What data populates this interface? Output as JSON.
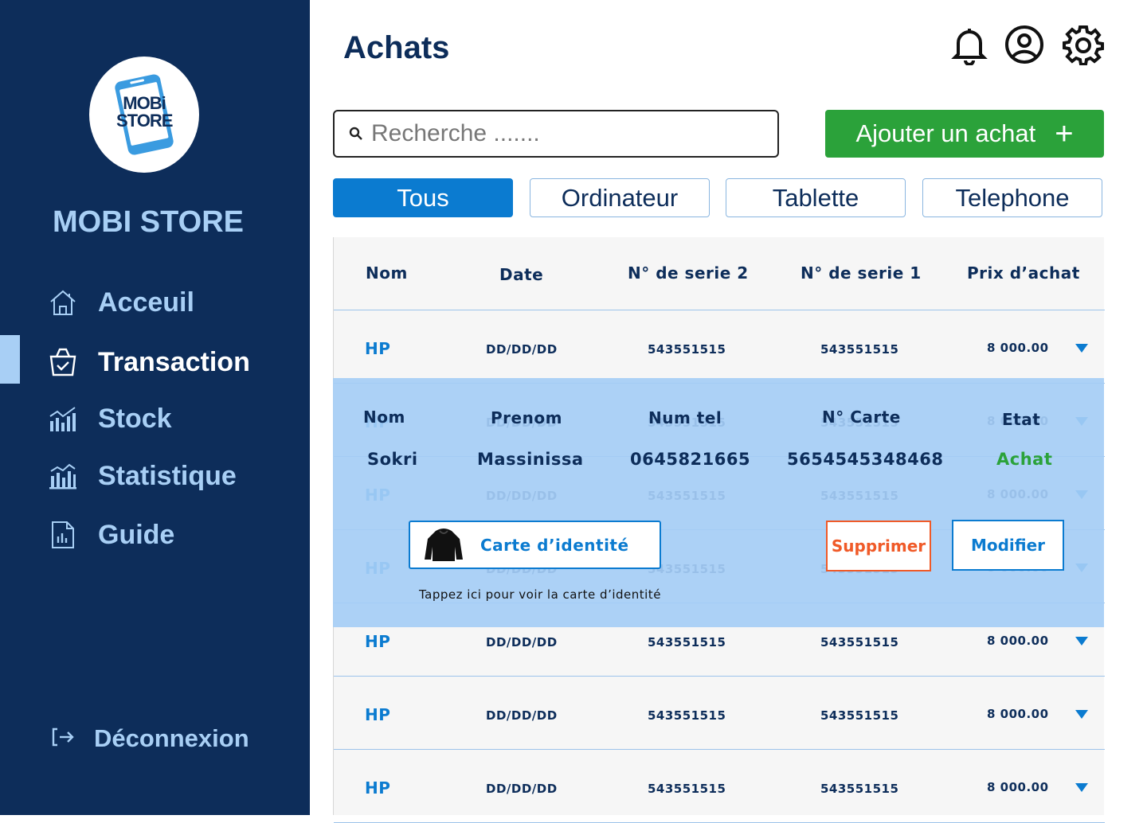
{
  "sidebar": {
    "logo_line1": "MOBi",
    "logo_line2": "STORE",
    "brand": "MOBI STORE",
    "nav": [
      {
        "label": "Acceuil",
        "icon": "home-icon"
      },
      {
        "label": "Transaction",
        "icon": "basket-check-icon",
        "active": true
      },
      {
        "label": "Stock",
        "icon": "bar-chart-icon"
      },
      {
        "label": "Statistique",
        "icon": "stats-chart-icon"
      },
      {
        "label": "Guide",
        "icon": "document-icon"
      }
    ],
    "logout": "Déconnexion"
  },
  "header": {
    "title": "Achats",
    "icons": [
      "bell-icon",
      "user-icon",
      "gear-icon"
    ]
  },
  "search": {
    "placeholder": "Recherche ......."
  },
  "add_button": {
    "label": "Ajouter un achat",
    "icon": "+"
  },
  "tabs": [
    {
      "label": "Tous",
      "active": true
    },
    {
      "label": "Ordinateur"
    },
    {
      "label": "Tablette"
    },
    {
      "label": "Telephone"
    }
  ],
  "table": {
    "columns": [
      "Nom",
      "Date",
      "N° de serie 2",
      "N° de serie 1",
      "Prix d’achat"
    ],
    "rows": [
      {
        "nom": "HP",
        "date": "DD/DD/DD",
        "serie2": "543551515",
        "serie1": "543551515",
        "prix": "8 000.00"
      },
      {
        "nom": "HP",
        "date": "DD/DD/DD",
        "serie2": "543551515",
        "serie1": "543551515",
        "prix": "8 000.00"
      },
      {
        "nom": "HP",
        "date": "DD/DD/DD",
        "serie2": "543551515",
        "serie1": "543551515",
        "prix": "8 000.00"
      },
      {
        "nom": "HP",
        "date": "DD/DD/DD",
        "serie2": "543551515",
        "serie1": "543551515",
        "prix": "8 000.00"
      },
      {
        "nom": "HP",
        "date": "DD/DD/DD",
        "serie2": "543551515",
        "serie1": "543551515",
        "prix": "8 000.00"
      },
      {
        "nom": "HP",
        "date": "DD/DD/DD",
        "serie2": "543551515",
        "serie1": "543551515",
        "prix": "8 000.00"
      },
      {
        "nom": "HP",
        "date": "DD/DD/DD",
        "serie2": "543551515",
        "serie1": "543551515",
        "prix": "8 000.00"
      }
    ]
  },
  "detail": {
    "headers": [
      "Nom",
      "Prenom",
      "Num tel",
      "N° Carte",
      "Etat"
    ],
    "values": {
      "nom": "Sokri",
      "prenom": "Massinissa",
      "tel": "0645821665",
      "carte": "5654545348468",
      "etat": "Achat"
    },
    "id_card_label": "Carte d’identité",
    "hint": "Tappez ici pour voir la carte d’identité",
    "delete_label": "Supprimer",
    "edit_label": "Modifier"
  },
  "colors": {
    "sidebar": "#0d2d5a",
    "accent": "#0b7bd0",
    "green": "#2ba23a",
    "danger": "#f05a28",
    "light_blue": "#a8cff5"
  }
}
